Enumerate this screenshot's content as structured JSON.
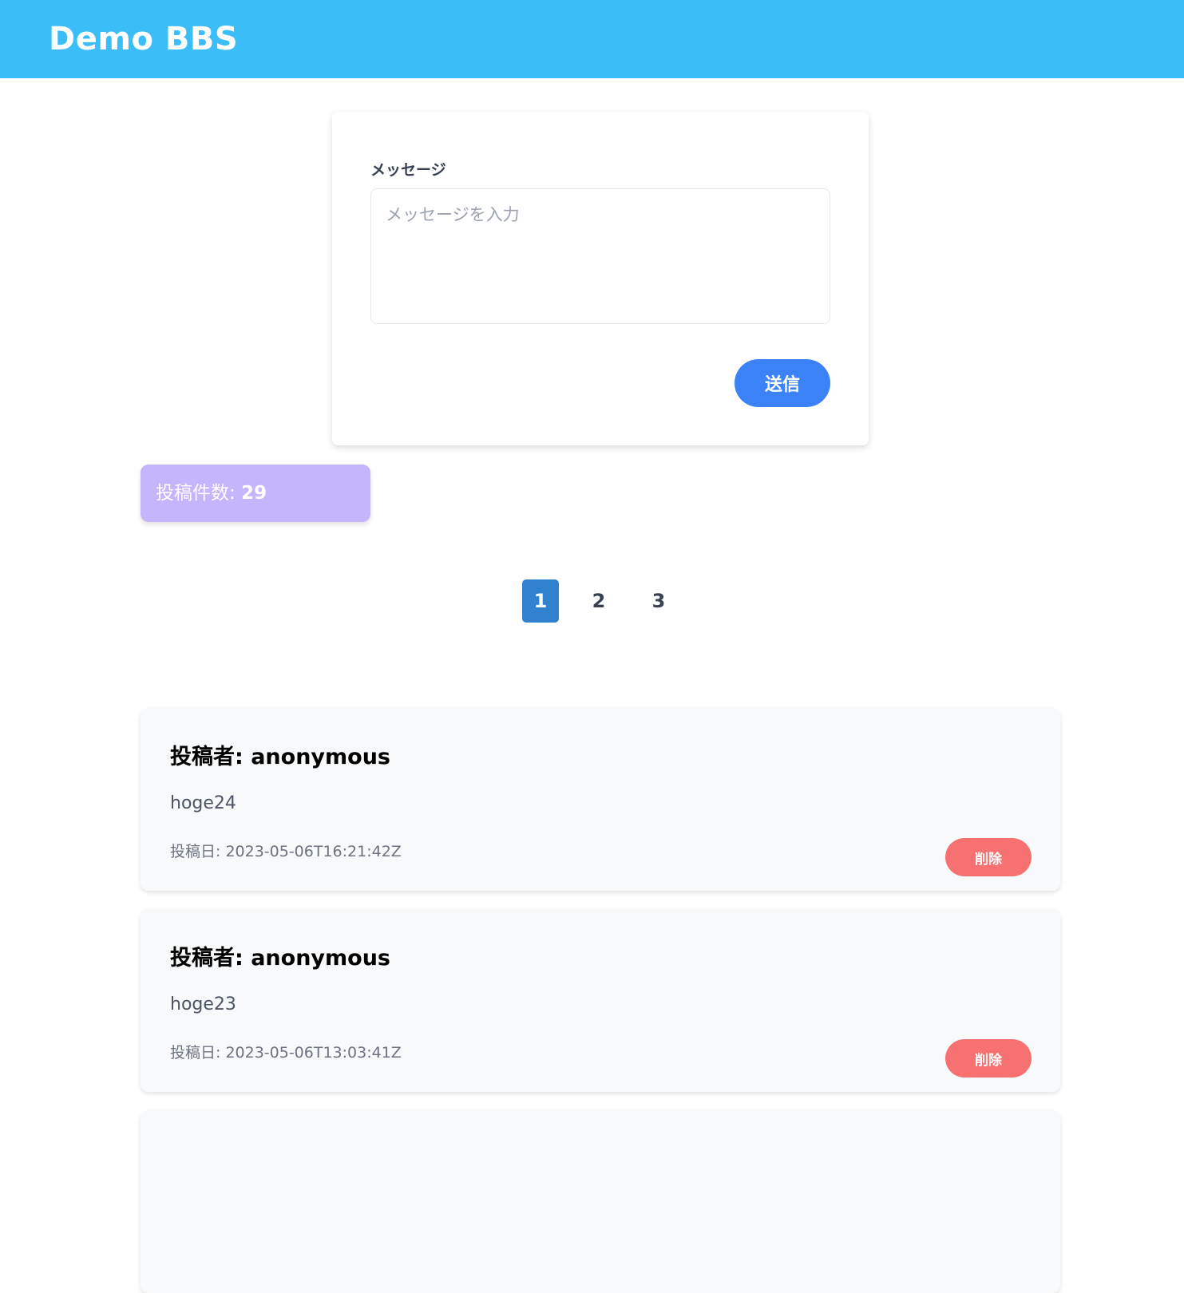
{
  "header": {
    "title": "Demo BBS"
  },
  "form": {
    "label": "メッセージ",
    "textarea_placeholder": "メッセージを入力",
    "textarea_value": "",
    "submit_label": "送信"
  },
  "stats": {
    "count_label": "投稿件数: ",
    "count_value": "29"
  },
  "pagination": {
    "pages": [
      "1",
      "2",
      "3"
    ],
    "current": "1"
  },
  "posts": [
    {
      "author": "投稿者: anonymous",
      "body": "hoge24",
      "date": "投稿日: 2023-05-06T16:21:42Z",
      "delete_label": "削除"
    },
    {
      "author": "投稿者: anonymous",
      "body": "hoge23",
      "date": "投稿日: 2023-05-06T13:03:41Z",
      "delete_label": "削除"
    },
    {
      "author": "",
      "body": "",
      "date": "",
      "delete_label": ""
    }
  ],
  "colors": {
    "header_bg": "#3bbdf8",
    "primary": "#3b82f6",
    "badge_bg": "#c4b5fd",
    "danger": "#f87171",
    "page_active": "#3182ce"
  }
}
